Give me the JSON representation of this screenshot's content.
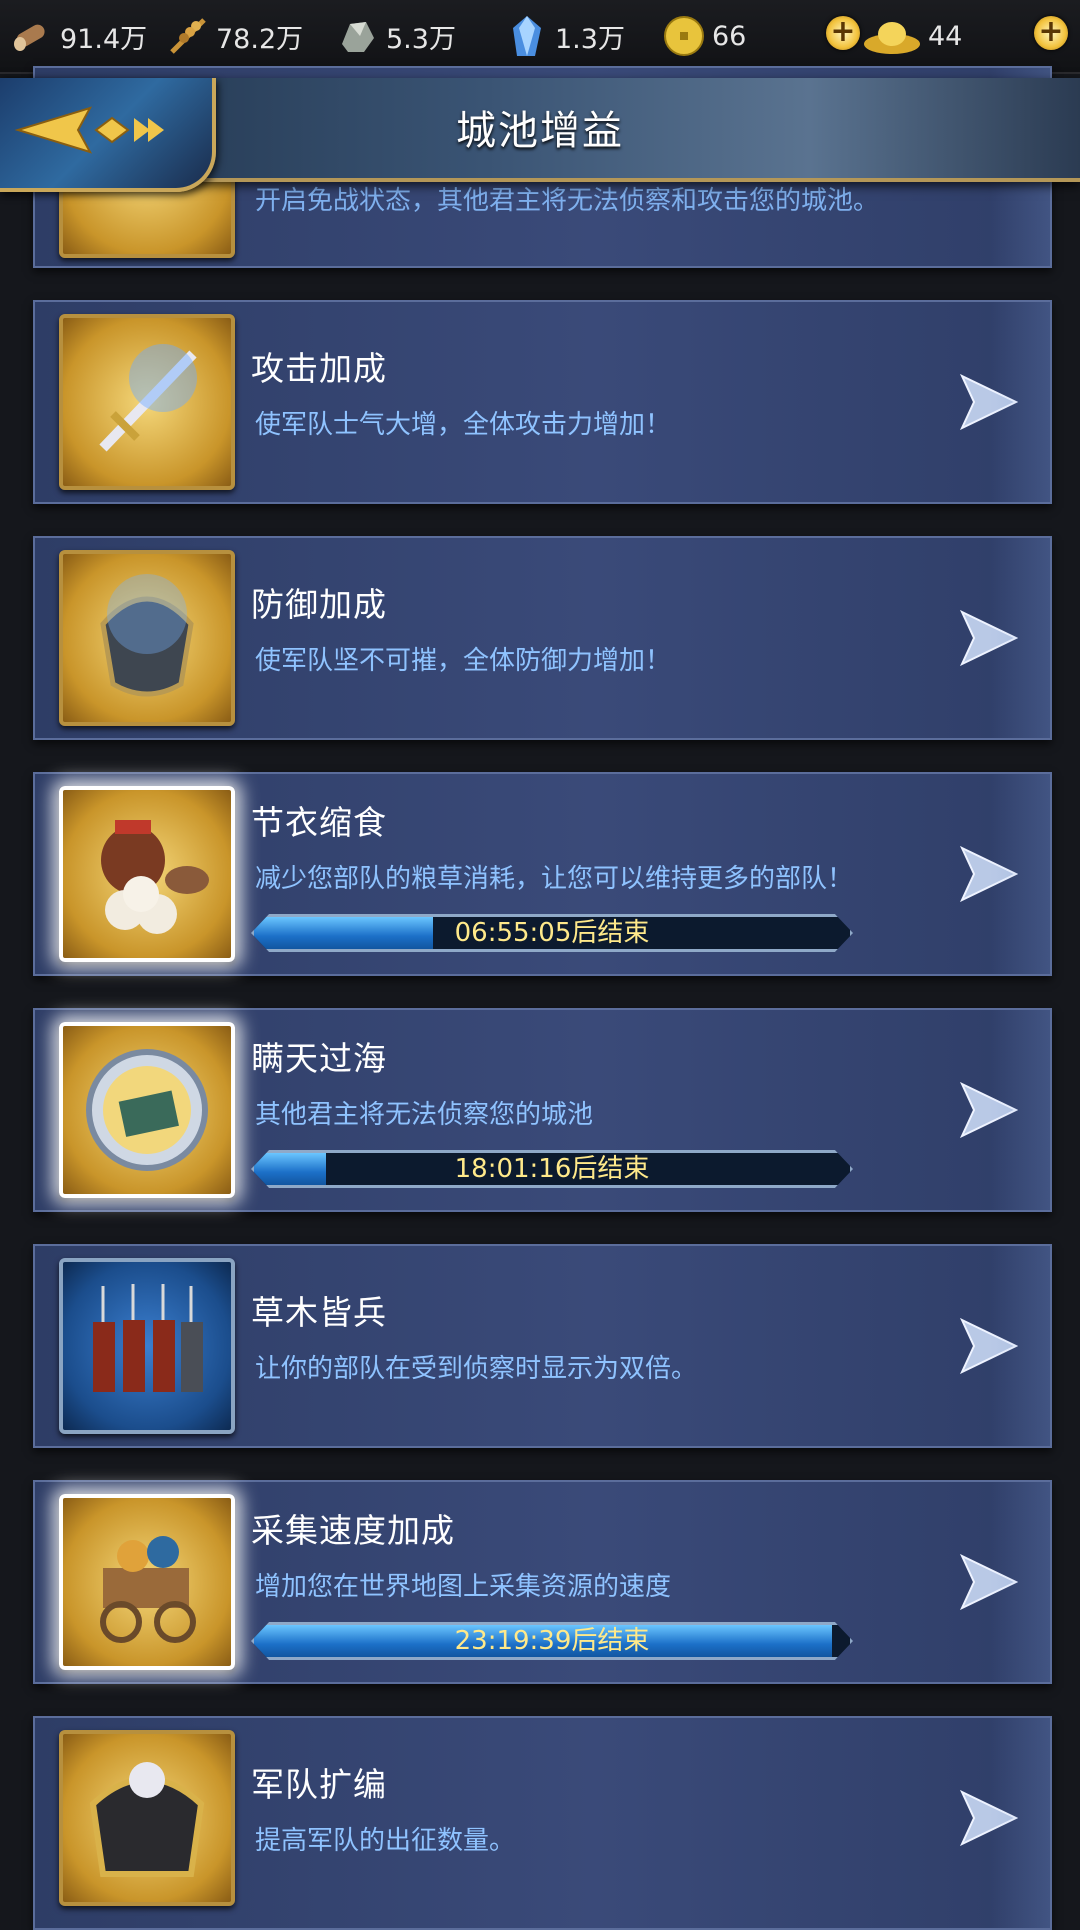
{
  "resources": [
    {
      "icon": "wood-icon",
      "value": "91.4万"
    },
    {
      "icon": "wheat-icon",
      "value": "78.2万"
    },
    {
      "icon": "ore-icon",
      "value": "5.3万"
    },
    {
      "icon": "crystal-icon",
      "value": "1.3万"
    },
    {
      "icon": "coin-icon",
      "value": "66"
    },
    {
      "icon": "gold-ingot-icon",
      "value": "44"
    }
  ],
  "header": {
    "title": "城池增益"
  },
  "buffs": [
    {
      "name": "",
      "desc": "开启免战状态，其他君主将无法侦察和攻击您的城池。",
      "icon": "shield-truce-icon"
    },
    {
      "name": "攻击加成",
      "desc": "使军队士气大增，全体攻击力增加！",
      "icon": "sword-icon"
    },
    {
      "name": "防御加成",
      "desc": "使军队坚不可摧，全体防御力增加！",
      "icon": "helmet-shield-icon"
    },
    {
      "name": "节衣缩食",
      "desc": "减少您部队的粮草消耗，让您可以维持更多的部队！",
      "icon": "food-jar-icon",
      "timer": "06:55:05后结束",
      "progress": 0.3
    },
    {
      "name": "瞒天过海",
      "desc": "其他君主将无法侦察您的城池",
      "icon": "compass-scroll-icon",
      "timer": "18:01:16后结束",
      "progress": 0.12
    },
    {
      "name": "草木皆兵",
      "desc": "让你的部队在受到侦察时显示为双倍。",
      "icon": "soldiers-icon"
    },
    {
      "name": "采集速度加成",
      "desc": "增加您在世界地图上采集资源的速度",
      "icon": "cart-icon",
      "timer": "23:19:39后结束",
      "progress": 0.97
    },
    {
      "name": "军队扩编",
      "desc": "提高军队的出征数量。",
      "icon": "armor-icon"
    }
  ]
}
